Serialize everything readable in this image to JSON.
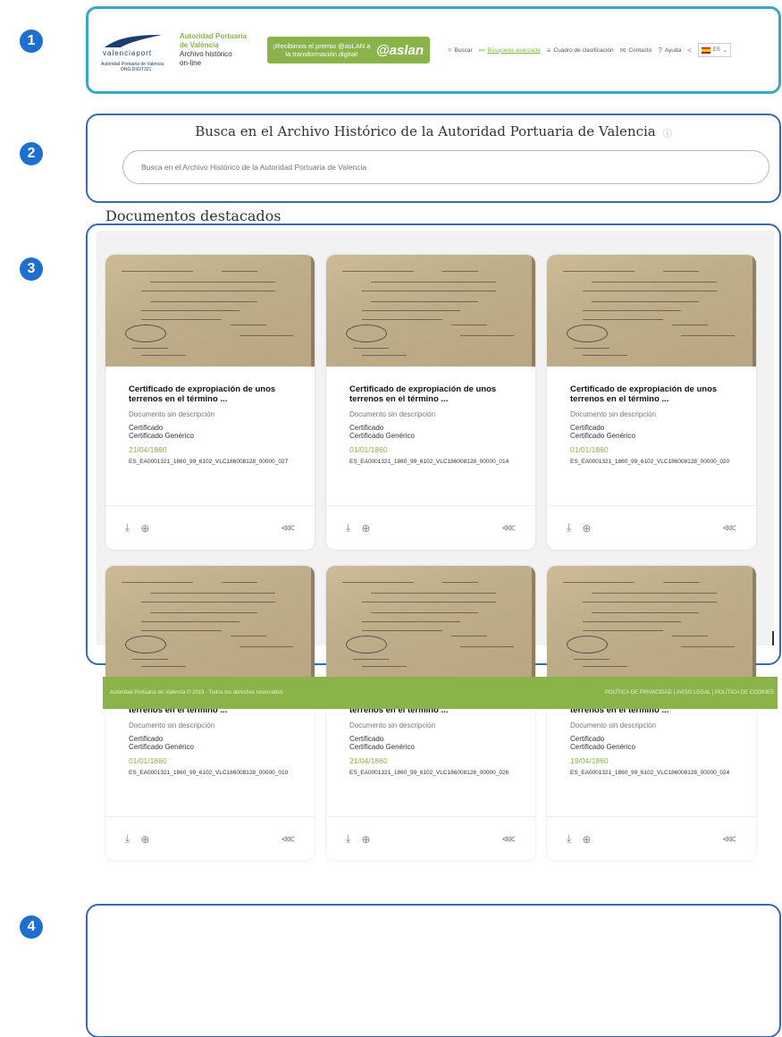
{
  "markers": [
    "1",
    "2",
    "3",
    "4"
  ],
  "header": {
    "logo": {
      "brand": "valenciaport",
      "sub1": "Autoridad Portuaria de Valencia",
      "sub2": "ONG DIGIT321"
    },
    "org": {
      "line1": "Autoridad Portuaria",
      "line2": "de València",
      "line3": "Archivo histórico",
      "line4": "on-line"
    },
    "award": {
      "text": "¡Recibimos el premio @asLAN a la transformación digital!",
      "brand": "@aslan"
    },
    "nav": {
      "search": "Buscar",
      "advanced": "Búsqueda avanzada",
      "classification": "Cuadro de clasificación",
      "contact": "Contacto",
      "help": "Ayuda",
      "lang": "ES"
    }
  },
  "search": {
    "title": "Busca en el Archivo Histórico de la Autoridad Portuaria de Valencia",
    "placeholder": "Busca en el Archivo Histórico de la Autoridad Portuaria de Valencia"
  },
  "featured": {
    "title": "Documentos destacados",
    "cards": [
      {
        "title": "Certificado de expropiación de unos terrenos en el término ...",
        "desc": "Documento sin descripción",
        "type1": "Certificado",
        "type2": "Certificado Genérico",
        "date": "21/04/1860",
        "code": "ES_EA0001321_1860_99_6102_VLC186008128_00000_027"
      },
      {
        "title": "Certificado de expropiación de unos terrenos en el término ...",
        "desc": "Documento sin descripción",
        "type1": "Certificado",
        "type2": "Certificado Genérico",
        "date": "01/01/1860",
        "code": "ES_EA0001321_1860_99_6102_VLC186008128_00000_014"
      },
      {
        "title": "Certificado de expropiación de unos terrenos en el término ...",
        "desc": "Documento sin descripción",
        "type1": "Certificado",
        "type2": "Certificado Genérico",
        "date": "01/01/1860",
        "code": "ES_EA0001321_1860_99_6102_VLC186008128_00000_020"
      },
      {
        "title": "Certificado de expropiación de unos terrenos en el término ...",
        "desc": "Documento sin descripción",
        "type1": "Certificado",
        "type2": "Certificado Genérico",
        "date": "01/01/1860",
        "code": "ES_EA0001321_1860_99_6102_VLC186008128_00000_010"
      },
      {
        "title": "Certificado de expropiación de unos terrenos en el término ...",
        "desc": "Documento sin descripción",
        "type1": "Certificado",
        "type2": "Certificado Genérico",
        "date": "21/04/1860",
        "code": "ES_EA0001321_1860_99_6102_VLC186008128_00000_026"
      },
      {
        "title": "Certificado de expropiación de unos terrenos en el término ...",
        "desc": "Documento sin descripción",
        "type1": "Certificado",
        "type2": "Certificado Genérico",
        "date": "19/04/1860",
        "code": "ES_EA0001321_1860_99_6102_VLC186008128_00000_024"
      }
    ]
  },
  "footer": {
    "left": "Autoridad Portuaria de València © 2019 - Todos los derechos reservados",
    "right": "POLÍTICA DE PRIVACIDAD | AVISO LEGAL | POLÍTICA DE COOKIES"
  },
  "colors": {
    "accent": "#8ab34a",
    "frame": "#3b68b3",
    "header_frame": "#3aa7c6",
    "marker": "#1f6fd1"
  },
  "icons": [
    "search-icon",
    "advanced-search-icon",
    "list-icon",
    "mail-icon",
    "help-icon",
    "share-icon",
    "download-icon",
    "add-icon",
    "info-icon",
    "chevron-down-icon"
  ]
}
